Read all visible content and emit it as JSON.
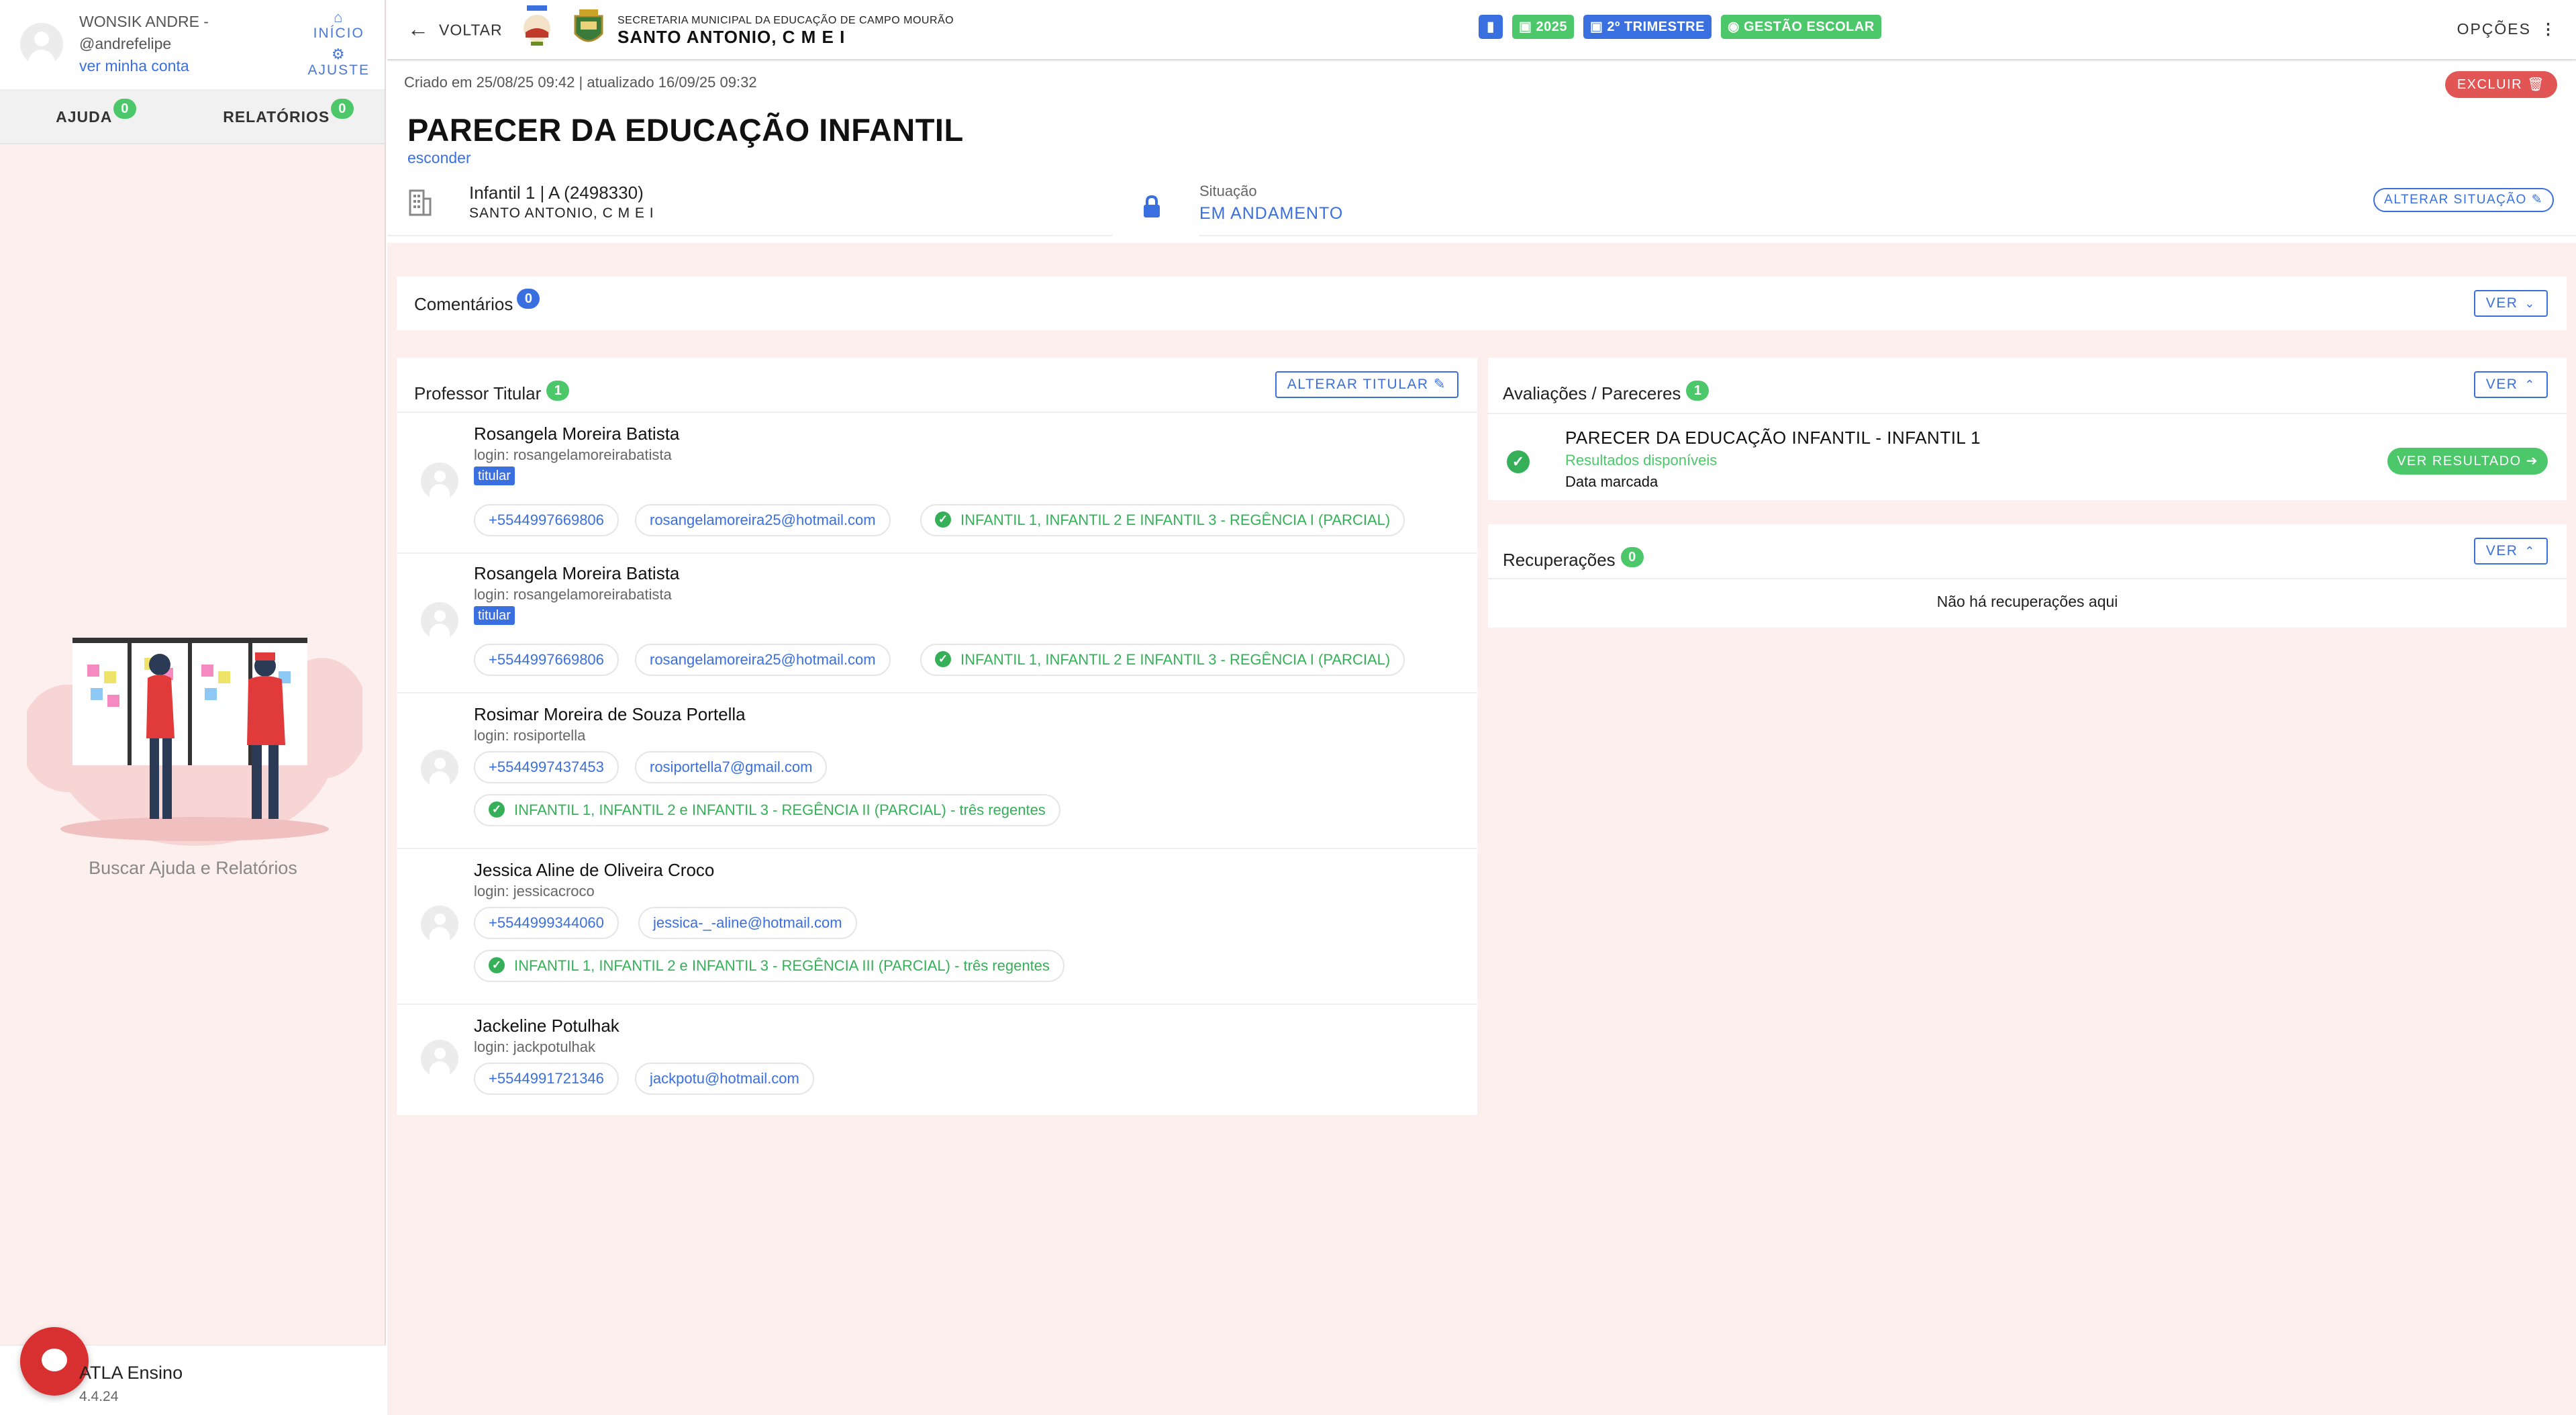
{
  "sidebar": {
    "user_name": "WONSIK ANDRE -",
    "user_handle": "@andrefelipe",
    "account_link": "ver minha conta",
    "nav_inicio": "INÍCIO",
    "nav_ajuste": "AJUSTE",
    "tab_ajuda": "AJUDA",
    "tab_ajuda_count": "0",
    "tab_relatorios": "RELATÓRIOS",
    "tab_relatorios_count": "0",
    "help_text": "Buscar Ajuda e Relatórios",
    "footer_app": "ATLA Ensino",
    "footer_version": "4.4.24"
  },
  "topbar": {
    "back_label": "VOLTAR",
    "secretaria": "SECRETARIA MUNICIPAL DA EDUCAÇÃO DE CAMPO MOURÃO",
    "school_name": "SANTO ANTONIO, C M E I",
    "chip_year": "2025",
    "chip_term": "2º TRIMESTRE",
    "chip_gestao": "GESTÃO ESCOLAR",
    "options_label": "OPÇÕES"
  },
  "header": {
    "meta": "Criado em 25/08/25 09:42 | atualizado 16/09/25 09:32",
    "delete_label": "EXCLUIR",
    "title": "PARECER DA EDUCAÇÃO INFANTIL",
    "hide_link": "esconder",
    "class_name": "Infantil 1 | A (2498330)",
    "class_school": "SANTO ANTONIO, C M E I",
    "situation_label": "Situação",
    "situation_value": "EM ANDAMENTO",
    "alter_situation": "ALTERAR SITUAÇÃO"
  },
  "comentarios": {
    "title": "Comentários",
    "count": "0",
    "button": "VER"
  },
  "professores": {
    "title": "Professor Titular",
    "count": "1",
    "alter_button": "ALTERAR TITULAR",
    "items": [
      {
        "name": "Rosangela Moreira Batista",
        "login": "login: rosangelamoreirabatista",
        "tag": "titular",
        "phone": "+5544997669806",
        "email": "rosangelamoreira25@hotmail.com",
        "discipline": "INFANTIL 1, INFANTIL 2 E INFANTIL 3 - REGÊNCIA I (PARCIAL)"
      },
      {
        "name": "Rosangela Moreira Batista",
        "login": "login: rosangelamoreirabatista",
        "tag": "titular",
        "phone": "+5544997669806",
        "email": "rosangelamoreira25@hotmail.com",
        "discipline": "INFANTIL 1, INFANTIL 2 E INFANTIL 3 - REGÊNCIA I (PARCIAL)"
      },
      {
        "name": "Rosimar Moreira de Souza Portella",
        "login": "login: rosiportella",
        "phone": "+5544997437453",
        "email": "rosiportella7@gmail.com",
        "discipline": "INFANTIL 1, INFANTIL 2 e INFANTIL 3 - REGÊNCIA II (PARCIAL) - três regentes"
      },
      {
        "name": "Jessica Aline de Oliveira Croco",
        "login": "login: jessicacroco",
        "phone": "+5544999344060",
        "email": "jessica-_-aline@hotmail.com",
        "discipline": "INFANTIL 1, INFANTIL 2 e INFANTIL 3 - REGÊNCIA III (PARCIAL) - três regentes"
      },
      {
        "name": "Jackeline Potulhak",
        "login": "login: jackpotulhak",
        "phone": "+5544991721346",
        "email": "jackpotu@hotmail.com"
      }
    ]
  },
  "avaliacoes": {
    "title": "Avaliações / Pareceres",
    "count": "1",
    "button": "VER",
    "item_title": "PARECER DA EDUCAÇÃO INFANTIL - INFANTIL 1",
    "item_status": "Resultados disponíveis",
    "item_date": "Data marcada",
    "item_button": "VER RESULTADO"
  },
  "recuperacoes": {
    "title": "Recuperações",
    "count": "0",
    "button": "VER",
    "empty": "Não há recuperações aqui"
  },
  "colors": {
    "accent_blue": "#3a6fe0",
    "success_green": "#4cc76a",
    "danger_red": "#e25555",
    "sidebar_bg": "#fcefee"
  }
}
